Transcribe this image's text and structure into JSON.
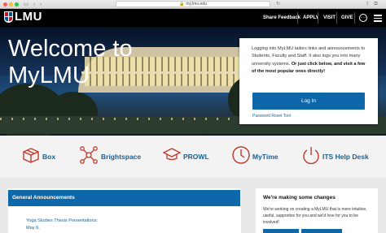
{
  "browser": {
    "url": "my.lmu.edu"
  },
  "header": {
    "logo_text": "LMU",
    "nav": {
      "share_feedback": "Share Feedback",
      "apply": "APPLY",
      "visit": "VISIT",
      "give": "GIVE"
    }
  },
  "hero": {
    "title": "Welcome to MyLMU",
    "login": {
      "text_plain": "Logging into MyLMU tailors links and announcements to Students, Faculty and Staff. It also logs you into many university systems.",
      "text_bold": "Or just click below, and visit a few of the most popular ones directly!",
      "button_label": "Log In",
      "reset_link": "Password Reset Tool"
    }
  },
  "quick_links": [
    {
      "label": "Box",
      "icon": "box-icon"
    },
    {
      "label": "Brightspace",
      "icon": "network-icon"
    },
    {
      "label": "PROWL",
      "icon": "graduation-cap-icon"
    },
    {
      "label": "MyTime",
      "icon": "clock-icon"
    },
    {
      "label": "ITS Help Desk",
      "icon": "power-icon"
    }
  ],
  "announcements": {
    "title": "General Announcements",
    "items": [
      "Yoga Studies Thesis Presentations: May 6,"
    ]
  },
  "changes": {
    "title": "We're making some changes",
    "text": "We're working on creating a MyLMU that is more intuitive, useful, supportive for you and we'd love for you to be involved!"
  },
  "colors": {
    "brand_blue": "#0e67a9",
    "brand_red": "#c8102e",
    "link_blue": "#1d5f8f"
  }
}
